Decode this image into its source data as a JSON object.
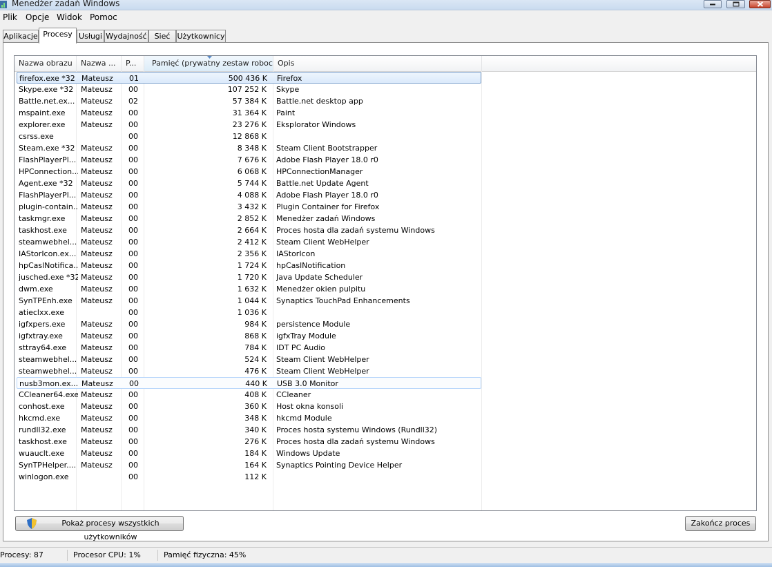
{
  "window": {
    "title": "Menedżer zadań Windows"
  },
  "menu": [
    "Plik",
    "Opcje",
    "Widok",
    "Pomoc"
  ],
  "tabs": [
    "Aplikacje",
    "Procesy",
    "Usługi",
    "Wydajność",
    "Sieć",
    "Użytkownicy"
  ],
  "active_tab": "Procesy",
  "columns": {
    "name": "Nazwa obrazu",
    "user": "Nazwa ...",
    "cpu": "P...",
    "memory": "Pamięć (prywatny zestaw roboczy)",
    "desc": "Opis"
  },
  "processes": [
    {
      "name": "firefox.exe *32",
      "user": "Mateusz",
      "cpu": "01",
      "mem": "500 436 K",
      "desc": "Firefox"
    },
    {
      "name": "Skype.exe *32",
      "user": "Mateusz",
      "cpu": "00",
      "mem": "107 252 K",
      "desc": "Skype"
    },
    {
      "name": "Battle.net.ex...",
      "user": "Mateusz",
      "cpu": "02",
      "mem": "57 384 K",
      "desc": "Battle.net desktop app"
    },
    {
      "name": "mspaint.exe",
      "user": "Mateusz",
      "cpu": "00",
      "mem": "31 364 K",
      "desc": "Paint"
    },
    {
      "name": "explorer.exe",
      "user": "Mateusz",
      "cpu": "00",
      "mem": "23 276 K",
      "desc": "Eksplorator Windows"
    },
    {
      "name": "csrss.exe",
      "user": "",
      "cpu": "00",
      "mem": "12 868 K",
      "desc": ""
    },
    {
      "name": "Steam.exe *32",
      "user": "Mateusz",
      "cpu": "00",
      "mem": "8 348 K",
      "desc": "Steam Client Bootstrapper"
    },
    {
      "name": "FlashPlayerPl...",
      "user": "Mateusz",
      "cpu": "00",
      "mem": "7 676 K",
      "desc": "Adobe Flash Player 18.0 r0"
    },
    {
      "name": "HPConnection...",
      "user": "Mateusz",
      "cpu": "00",
      "mem": "6 068 K",
      "desc": "HPConnectionManager"
    },
    {
      "name": "Agent.exe *32",
      "user": "Mateusz",
      "cpu": "00",
      "mem": "5 744 K",
      "desc": "Battle.net Update Agent"
    },
    {
      "name": "FlashPlayerPl...",
      "user": "Mateusz",
      "cpu": "00",
      "mem": "4 088 K",
      "desc": "Adobe Flash Player 18.0 r0"
    },
    {
      "name": "plugin-contain...",
      "user": "Mateusz",
      "cpu": "00",
      "mem": "3 432 K",
      "desc": "Plugin Container for Firefox"
    },
    {
      "name": "taskmgr.exe",
      "user": "Mateusz",
      "cpu": "00",
      "mem": "2 852 K",
      "desc": "Menedżer zadań Windows"
    },
    {
      "name": "taskhost.exe",
      "user": "Mateusz",
      "cpu": "00",
      "mem": "2 664 K",
      "desc": "Proces hosta dla zadań systemu Windows"
    },
    {
      "name": "steamwebhel...",
      "user": "Mateusz",
      "cpu": "00",
      "mem": "2 412 K",
      "desc": "Steam Client WebHelper"
    },
    {
      "name": "IAStorIcon.ex...",
      "user": "Mateusz",
      "cpu": "00",
      "mem": "2 356 K",
      "desc": "IAStorIcon"
    },
    {
      "name": "hpCaslNotifica...",
      "user": "Mateusz",
      "cpu": "00",
      "mem": "1 724 K",
      "desc": "hpCaslNotification"
    },
    {
      "name": "jusched.exe *32",
      "user": "Mateusz",
      "cpu": "00",
      "mem": "1 720 K",
      "desc": "Java Update Scheduler"
    },
    {
      "name": "dwm.exe",
      "user": "Mateusz",
      "cpu": "00",
      "mem": "1 632 K",
      "desc": "Menedżer okien pulpitu"
    },
    {
      "name": "SynTPEnh.exe",
      "user": "Mateusz",
      "cpu": "00",
      "mem": "1 044 K",
      "desc": "Synaptics TouchPad Enhancements"
    },
    {
      "name": "atieclxx.exe",
      "user": "",
      "cpu": "00",
      "mem": "1 036 K",
      "desc": ""
    },
    {
      "name": "igfxpers.exe",
      "user": "Mateusz",
      "cpu": "00",
      "mem": "984 K",
      "desc": "persistence Module"
    },
    {
      "name": "igfxtray.exe",
      "user": "Mateusz",
      "cpu": "00",
      "mem": "868 K",
      "desc": "igfxTray Module"
    },
    {
      "name": "sttray64.exe",
      "user": "Mateusz",
      "cpu": "00",
      "mem": "784 K",
      "desc": "IDT PC Audio"
    },
    {
      "name": "steamwebhel...",
      "user": "Mateusz",
      "cpu": "00",
      "mem": "524 K",
      "desc": "Steam Client WebHelper"
    },
    {
      "name": "steamwebhel...",
      "user": "Mateusz",
      "cpu": "00",
      "mem": "476 K",
      "desc": "Steam Client WebHelper"
    },
    {
      "name": "nusb3mon.ex...",
      "user": "Mateusz",
      "cpu": "00",
      "mem": "440 K",
      "desc": "USB 3.0 Monitor"
    },
    {
      "name": "CCleaner64.exe",
      "user": "Mateusz",
      "cpu": "00",
      "mem": "408 K",
      "desc": "CCleaner"
    },
    {
      "name": "conhost.exe",
      "user": "Mateusz",
      "cpu": "00",
      "mem": "360 K",
      "desc": "Host okna konsoli"
    },
    {
      "name": "hkcmd.exe",
      "user": "Mateusz",
      "cpu": "00",
      "mem": "348 K",
      "desc": "hkcmd Module"
    },
    {
      "name": "rundll32.exe",
      "user": "Mateusz",
      "cpu": "00",
      "mem": "340 K",
      "desc": "Proces hosta systemu Windows (Rundll32)"
    },
    {
      "name": "taskhost.exe",
      "user": "Mateusz",
      "cpu": "00",
      "mem": "276 K",
      "desc": "Proces hosta dla zadań systemu Windows"
    },
    {
      "name": "wuauclt.exe",
      "user": "Mateusz",
      "cpu": "00",
      "mem": "184 K",
      "desc": "Windows Update"
    },
    {
      "name": "SynTPHelper....",
      "user": "Mateusz",
      "cpu": "00",
      "mem": "164 K",
      "desc": "Synaptics Pointing Device Helper"
    },
    {
      "name": "winlogon.exe",
      "user": "",
      "cpu": "00",
      "mem": "112 K",
      "desc": ""
    }
  ],
  "selected_row": 0,
  "hover_row": 26,
  "buttons": {
    "show_all": "Pokaż procesy wszystkich użytkowników",
    "end_process": "Zakończ proces"
  },
  "status": {
    "processes": "Procesy: 87",
    "cpu": "Procesor CPU: 1%",
    "memory": "Pamięć fizyczna: 45%"
  },
  "icons": [
    "app-icon",
    "minimize-icon",
    "maximize-icon",
    "close-icon",
    "sort-arrow-icon",
    "uac-shield-icon"
  ]
}
